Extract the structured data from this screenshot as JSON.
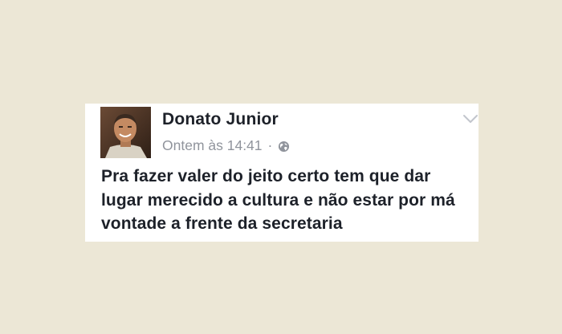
{
  "post": {
    "author": "Donato Junior",
    "timestamp": "Ontem às 14:41",
    "separator": "·",
    "privacy_icon": "globe-icon",
    "menu_icon": "chevron-down-icon",
    "text": "Pra fazer valer do jeito certo tem que dar lugar merecido a cultura e não estar por má vontade a frente da secretaria"
  },
  "colors": {
    "background": "#ece7d6",
    "card": "#ffffff",
    "text": "#1d2129",
    "meta": "#90949c"
  }
}
